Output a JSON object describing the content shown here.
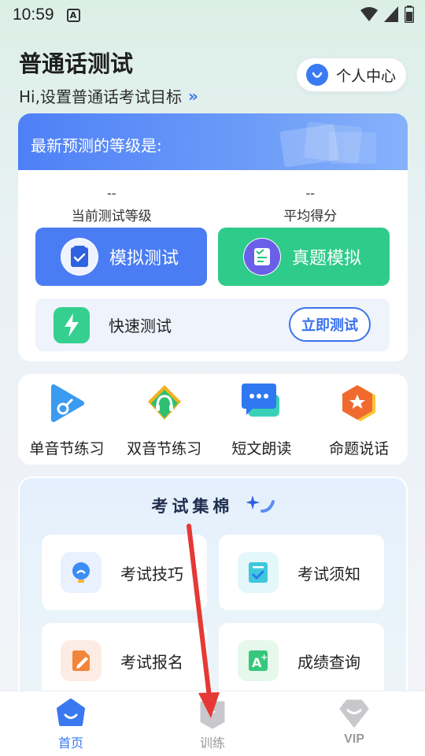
{
  "status_bar": {
    "time": "10:59",
    "notification_icon": "a-icon"
  },
  "header": {
    "title": "普通话测试",
    "subtitle": "Hi,设置普通话考试目标",
    "subtitle_chevron": "»",
    "personal_center": "个人中心"
  },
  "predict": {
    "heading": "最新预测的等级是:",
    "stats": [
      {
        "value": "--",
        "label": "当前测试等级"
      },
      {
        "value": "--",
        "label": "平均得分"
      }
    ],
    "mock_test": "模拟测试",
    "real_mock": "真题模拟",
    "quick_test": "快速测试",
    "quick_test_button": "立即测试"
  },
  "practice": [
    {
      "label": "单音节练习",
      "icon": "play-icon"
    },
    {
      "label": "双音节练习",
      "icon": "headphone-icon"
    },
    {
      "label": "短文朗读",
      "icon": "chat-icon"
    },
    {
      "label": "命题说话",
      "icon": "star-icon"
    }
  ],
  "exam_collection": {
    "title": "考试集棉",
    "tiles": [
      {
        "label": "考试技巧",
        "icon": "lightbulb-icon"
      },
      {
        "label": "考试须知",
        "icon": "checklist-icon"
      },
      {
        "label": "考试报名",
        "icon": "edit-icon"
      },
      {
        "label": "成绩查询",
        "icon": "grade-icon"
      }
    ]
  },
  "nav": [
    {
      "label": "首页",
      "icon": "home-icon",
      "active": true
    },
    {
      "label": "训练",
      "icon": "training-icon",
      "active": false
    },
    {
      "label": "VIP",
      "icon": "vip-icon",
      "active": false
    }
  ],
  "colors": {
    "accent_blue": "#4a7cf3",
    "accent_green": "#2fcb8a",
    "annotation_red": "#e53935"
  }
}
